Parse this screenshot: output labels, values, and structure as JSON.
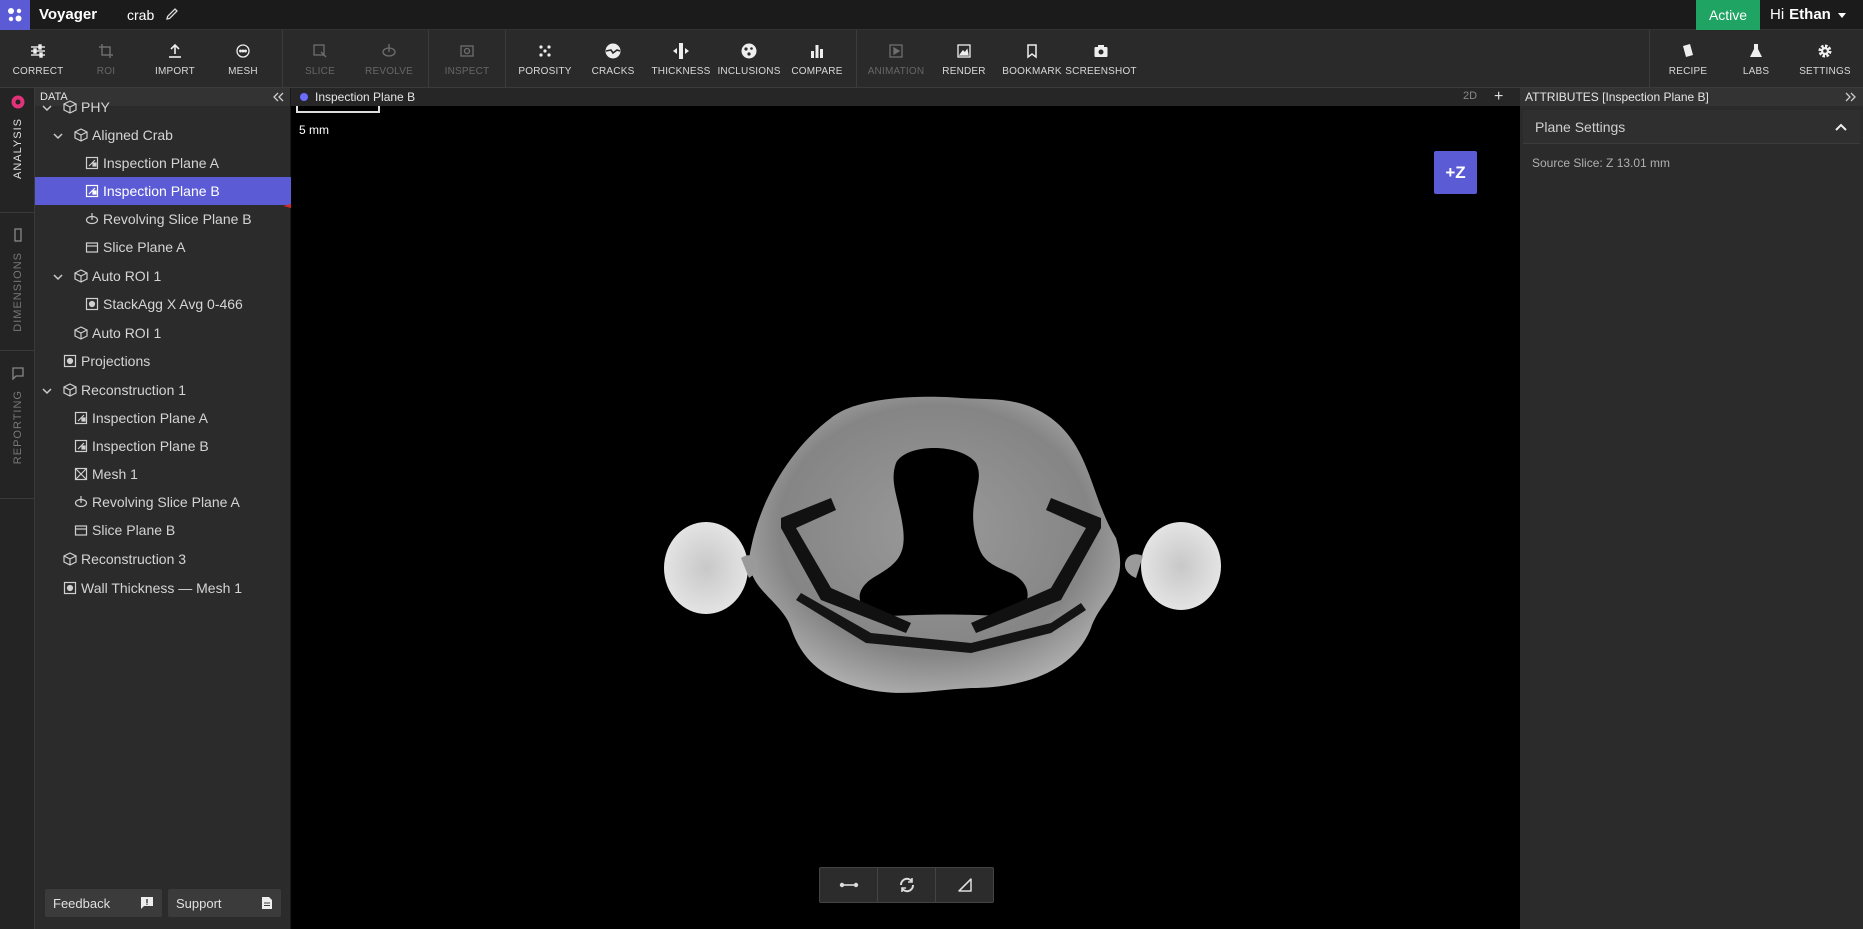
{
  "app": {
    "title": "Voyager",
    "project": "crab"
  },
  "status": "Active",
  "user": {
    "greeting": "Hi",
    "name": "Ethan"
  },
  "toolbar": {
    "correct": "CORRECT",
    "roi": "ROI",
    "import": "IMPORT",
    "mesh": "MESH",
    "slice": "SLICE",
    "revolve": "REVOLVE",
    "inspect": "INSPECT",
    "porosity": "POROSITY",
    "cracks": "CRACKS",
    "thickness": "THICKNESS",
    "inclusions": "INCLUSIONS",
    "compare": "COMPARE",
    "animation": "ANIMATION",
    "render": "RENDER",
    "bookmark": "BOOKMARK",
    "screenshot": "SCREENSHOT",
    "recipe": "RECIPE",
    "labs": "LABS",
    "settings": "SETTINGS"
  },
  "rail": {
    "analysis": "ANALYSIS",
    "dimensions": "DIMENSIONS",
    "reporting": "REPORTING"
  },
  "data_panel": {
    "title": "DATA",
    "tree": [
      {
        "label": "PHY"
      },
      {
        "label": "Aligned Crab"
      },
      {
        "label": "Inspection Plane A"
      },
      {
        "label": "Inspection Plane B"
      },
      {
        "label": "Revolving Slice Plane B"
      },
      {
        "label": "Slice Plane A"
      },
      {
        "label": "Auto ROI 1"
      },
      {
        "label": "StackAgg X Avg 0-466"
      },
      {
        "label": "Auto ROI 1"
      },
      {
        "label": "Projections"
      },
      {
        "label": "Reconstruction 1"
      },
      {
        "label": "Inspection Plane A"
      },
      {
        "label": "Inspection Plane B"
      },
      {
        "label": "Mesh 1"
      },
      {
        "label": "Revolving Slice Plane A"
      },
      {
        "label": "Slice Plane B"
      },
      {
        "label": "Reconstruction 3"
      },
      {
        "label": "Wall Thickness — Mesh 1"
      }
    ],
    "feedback": "Feedback",
    "support": "Support"
  },
  "viewport": {
    "title": "Inspection Plane B",
    "mode": "2D",
    "scale_label": "5 mm",
    "axis_button": "+Z"
  },
  "attributes": {
    "title": "ATTRIBUTES [Inspection Plane B]",
    "section": "Plane Settings",
    "source_slice": "Source Slice: Z 13.01 mm"
  },
  "colors": {
    "accent": "#5b5bd6",
    "active": "#1fa463",
    "annotation": "#d42a2a"
  }
}
